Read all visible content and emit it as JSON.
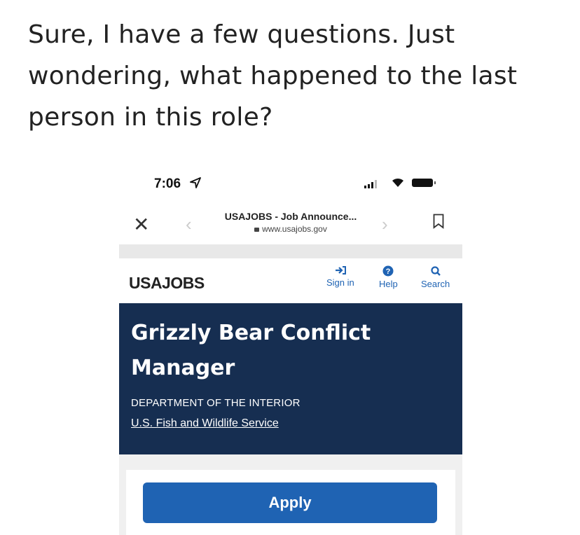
{
  "caption": "Sure, I have a few questions. Just wondering, what happened to the last person in this role?",
  "status_bar": {
    "time": "7:06"
  },
  "browser": {
    "page_title": "USAJOBS - Job Announce...",
    "url": "www.usajobs.gov"
  },
  "site_header": {
    "logo": "USAJOBS",
    "nav": [
      {
        "label": "Sign in",
        "icon": "sign-in-icon"
      },
      {
        "label": "Help",
        "icon": "help-icon"
      },
      {
        "label": "Search",
        "icon": "search-icon"
      }
    ]
  },
  "job": {
    "title": "Grizzly Bear Conflict Manager",
    "department": "DEPARTMENT OF THE INTERIOR",
    "agency": "U.S. Fish and Wildlife Service"
  },
  "apply_label": "Apply",
  "colors": {
    "nav_blue": "#1f63b3",
    "banner_navy": "#162e51",
    "background": "#ffffff"
  }
}
